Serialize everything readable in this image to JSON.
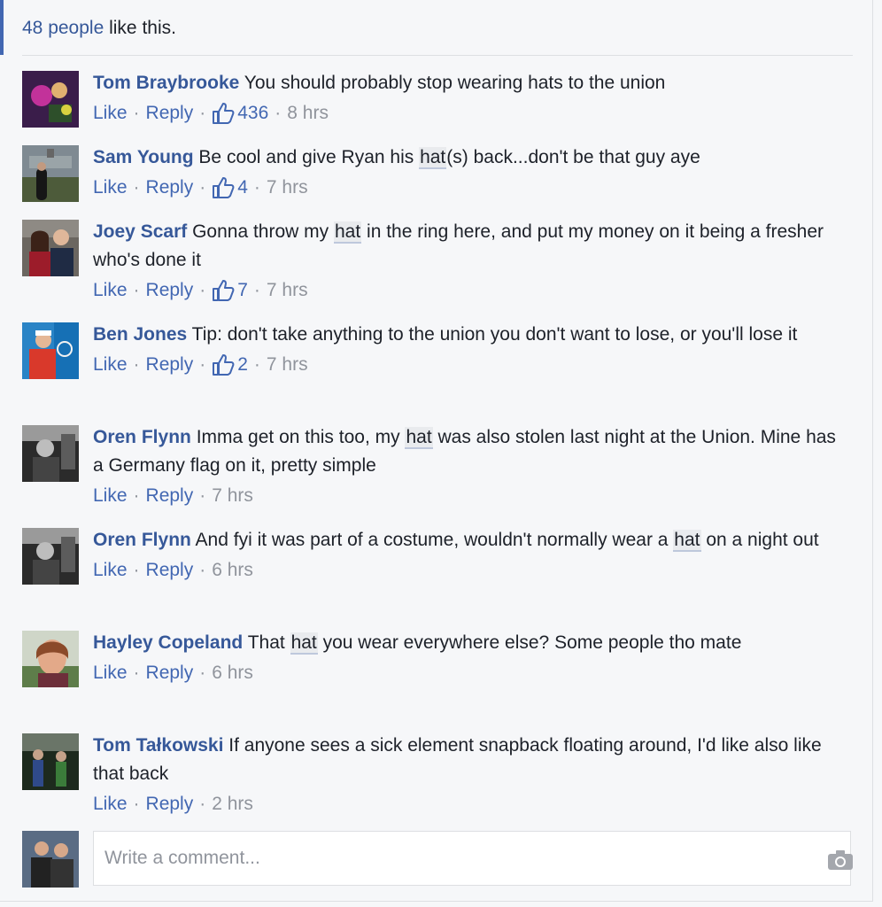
{
  "likes_summary": {
    "count_link": "48 people",
    "suffix": " like this."
  },
  "comments": [
    {
      "author": "Tom Braybrooke",
      "segments": [
        "You should probably stop wearing hats to the union"
      ],
      "like": "Like",
      "reply": "Reply",
      "likes": "436",
      "time": "8 hrs"
    },
    {
      "author": "Sam Young",
      "segments": [
        "Be cool and give Ryan his ",
        "hat",
        "(s) back...don't be that guy aye"
      ],
      "like": "Like",
      "reply": "Reply",
      "likes": "4",
      "time": "7 hrs"
    },
    {
      "author": "Joey Scarf",
      "segments": [
        "Gonna throw my ",
        "hat",
        " in the ring here, and put my money on it being a fresher who's done it"
      ],
      "like": "Like",
      "reply": "Reply",
      "likes": "7",
      "time": "7 hrs"
    },
    {
      "author": "Ben Jones",
      "segments": [
        "Tip: don't take anything to the union you don't want to lose, or you'll lose it"
      ],
      "like": "Like",
      "reply": "Reply",
      "likes": "2",
      "time": "7 hrs"
    },
    {
      "author": "Oren Flynn",
      "segments": [
        "Imma get on this too, my ",
        "hat",
        " was also stolen last night at the Union. Mine has a Germany flag on it, pretty simple"
      ],
      "like": "Like",
      "reply": "Reply",
      "likes": "",
      "time": "7 hrs"
    },
    {
      "author": "Oren Flynn",
      "segments": [
        "And fyi it was part of a costume, wouldn't normally wear a ",
        "hat",
        " on a night out"
      ],
      "like": "Like",
      "reply": "Reply",
      "likes": "",
      "time": "6 hrs"
    },
    {
      "author": "Hayley Copeland",
      "segments": [
        "That ",
        "hat",
        " you wear everywhere else? Some people tho mate"
      ],
      "like": "Like",
      "reply": "Reply",
      "likes": "",
      "time": "6 hrs"
    },
    {
      "author": "Tom Tałkowski",
      "segments": [
        "If anyone sees a sick element snapback floating around, I'd like also like that back"
      ],
      "like": "Like",
      "reply": "Reply",
      "likes": "",
      "time": "2 hrs"
    }
  ],
  "composer": {
    "placeholder": "Write a comment..."
  },
  "icons": {
    "thumbs": "thumbs-up-icon",
    "camera": "camera-icon",
    "emoji": "smiley-icon"
  },
  "colors": {
    "link": "#365899",
    "action": "#4267b2",
    "muted": "#90949c",
    "highlight": "#e9ebee"
  }
}
